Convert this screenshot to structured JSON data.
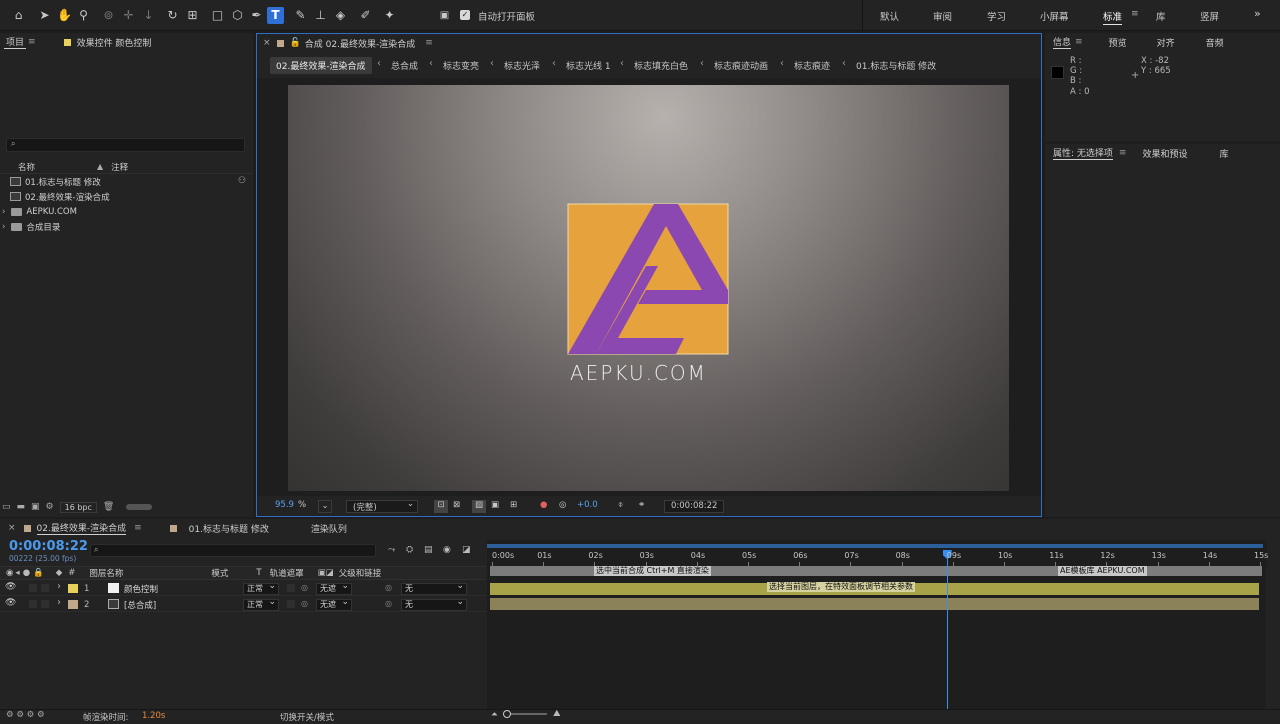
{
  "toolbar": {
    "auto_open_label": "自动打开面板",
    "workspaces": [
      "默认",
      "审阅",
      "学习",
      "小屏幕",
      "标准",
      "库",
      "竖屏"
    ],
    "active_workspace": "标准",
    "more": "»"
  },
  "project_panel": {
    "tab_label": "项目",
    "effects_tab_label": "效果控件 颜色控制",
    "search_placeholder": "⌕",
    "col_name": "名称",
    "col_comment": "注释",
    "items": [
      {
        "name": "01.标志与标题 修改",
        "type": "comp"
      },
      {
        "name": "02.最终效果-渲染合成",
        "type": "comp"
      },
      {
        "name": "AEPKU.COM",
        "type": "folder"
      },
      {
        "name": "合成目录",
        "type": "folder"
      }
    ],
    "bpc": "16 bpc"
  },
  "comp_panel": {
    "tab_label": "合成 02.最终效果-渲染合成",
    "breadcrumbs": [
      "02.最终效果-渲染合成",
      "总合成",
      "标志变亮",
      "标志光泽",
      "标志光线 1",
      "标志填充白色",
      "标志痕迹动画",
      "标志痕迹",
      "01.标志与标题 修改"
    ],
    "logo_text": "AEPKU.COM",
    "zoom": "95.9",
    "zoom_unit": "%",
    "quality": "(完整)",
    "exposure": "+0.0",
    "timecode": "0:00:08:22"
  },
  "info_panel": {
    "tabs": [
      "信息",
      "预览",
      "对齐",
      "音频"
    ],
    "r": "R :",
    "g": "G :",
    "b": "B :",
    "a": "A : 0",
    "x": "X : -82",
    "y": "Y : 665"
  },
  "properties_panel": {
    "tabs": [
      "属性: 无选择项",
      "效果和预设",
      "库"
    ]
  },
  "timeline": {
    "tabs": [
      "02.最终效果-渲染合成",
      "01.标志与标题 修改",
      "渲染队列"
    ],
    "timecode": "0:00:08:22",
    "frame_info": "00222 (25.00 fps)",
    "search_placeholder": "⌕",
    "col_layer_name": "图层名称",
    "col_mode": "模式",
    "col_t": "T",
    "col_track": "轨道遮罩",
    "col_parent": "父级和链接",
    "layers": [
      {
        "num": "1",
        "name": "颜色控制",
        "mode": "正常",
        "track": "无遮",
        "parent": "无",
        "color": "#e8d15a"
      },
      {
        "num": "2",
        "name": "[总合成]",
        "mode": "正常",
        "track": "无遮",
        "parent": "无",
        "color": "#bfa98a"
      }
    ],
    "ruler": [
      "0:00s",
      "01s",
      "02s",
      "03s",
      "04s",
      "05s",
      "06s",
      "07s",
      "08s",
      "09s",
      "10s",
      "11s",
      "12s",
      "13s",
      "14s",
      "15s"
    ],
    "markers": [
      "选中当前合成  Ctrl+M  直接渲染",
      "AE模板库  AEPKU.COM"
    ],
    "layer_marker": "选择当前图层，在特效面板调节相关参数",
    "playhead_seconds": 8.88,
    "duration_seconds": 15
  },
  "statusbar": {
    "render_time_label": "帧渲染时间:",
    "render_time_value": "1.20s",
    "toggle_label": "切换开关/模式"
  },
  "colors": {
    "accent_blue": "#2d8ceb",
    "layer1_bar": "#a8a248",
    "layer2_bar": "#8c8259",
    "logo_orange": "#e6a23c",
    "logo_purple": "#8a48b0"
  }
}
